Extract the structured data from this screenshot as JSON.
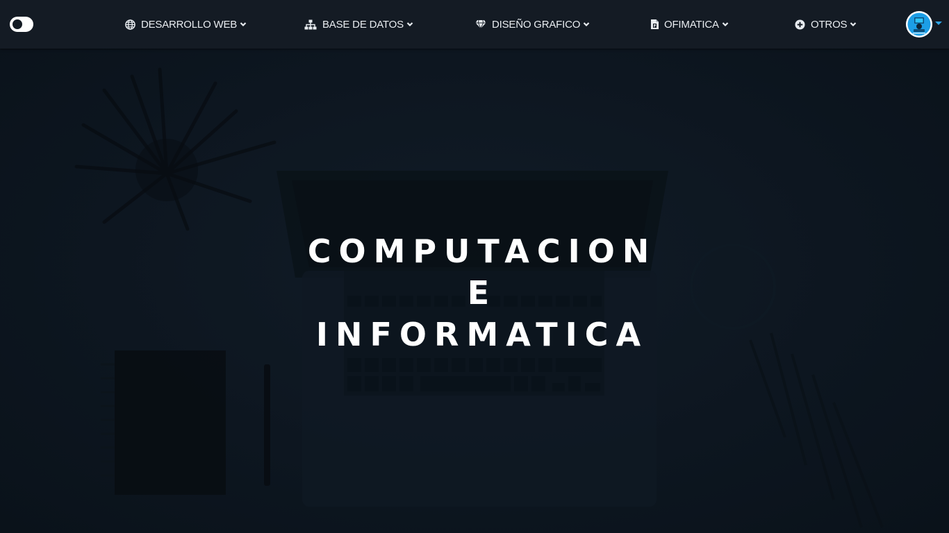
{
  "navbar": {
    "theme_toggle": {
      "icon": "toggle-switch-icon"
    },
    "items": [
      {
        "label": "DESARROLLO WEB",
        "icon": "globe-icon"
      },
      {
        "label": "BASE DE DATOS",
        "icon": "sitemap-icon"
      },
      {
        "label": "DISEÑO GRAFICO",
        "icon": "diamond-icon"
      },
      {
        "label": "OFIMATICA",
        "icon": "file-icon"
      },
      {
        "label": "OTROS",
        "icon": "plus-circle-icon"
      }
    ],
    "user_menu": {
      "avatar_icon": "user-avatar",
      "caret_icon": "caret-down-icon"
    }
  },
  "hero": {
    "title_lines": [
      "COMPUTACION",
      "E",
      "INFORMATICA"
    ]
  },
  "colors": {
    "navbar_bg": "#141b24",
    "hero_bg": "#0d151e",
    "text": "#ffffff",
    "accent": "#2fa6e8"
  }
}
